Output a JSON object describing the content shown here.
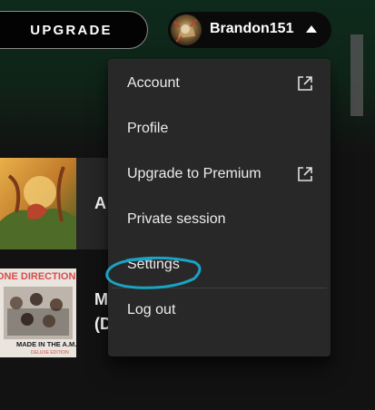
{
  "header": {
    "upgrade_label": "UPGRADE",
    "username": "Brandon151"
  },
  "menu": {
    "items": [
      {
        "label": "Account",
        "external": true
      },
      {
        "label": "Profile",
        "external": false
      },
      {
        "label": "Upgrade to Premium",
        "external": true
      },
      {
        "label": "Private session",
        "external": false
      },
      {
        "label": "Settings",
        "external": false
      },
      {
        "label": "Log out",
        "external": false
      }
    ],
    "highlighted_item": "Settings"
  },
  "content": {
    "rows": [
      {
        "title_partial": "A"
      },
      {
        "title_partial_line1": "M",
        "title_partial_line2": "(D"
      }
    ],
    "album_art_2": {
      "band_text": "ONE DIRECTION",
      "album_text": "MADE IN THE A.M.",
      "edition_text": "DELUXE EDITION"
    }
  },
  "colors": {
    "background": "#121212",
    "header_gradient_top": "#0d2a1c",
    "menu_bg": "#282828",
    "row_highlight": "#272727",
    "annotation_stroke": "#1aa3c4",
    "text": "#ffffff"
  },
  "icons": {
    "external_link": "external-link-icon",
    "caret": "caret-up-icon"
  }
}
